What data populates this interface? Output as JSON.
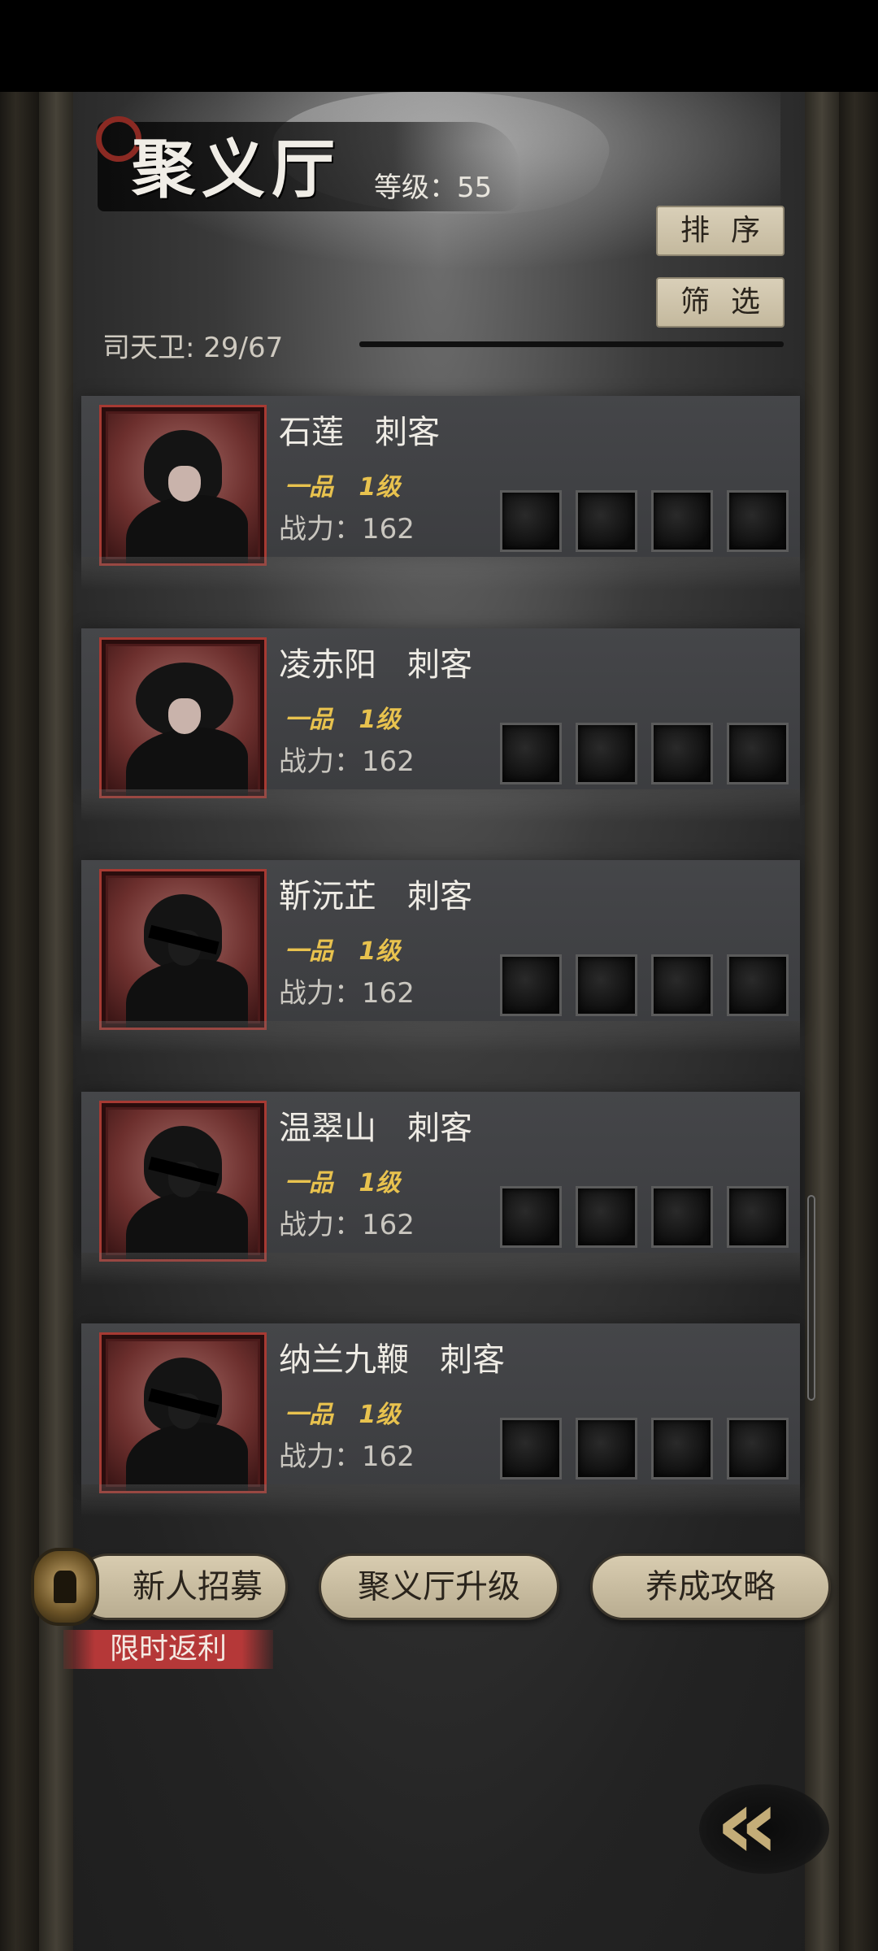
{
  "header": {
    "title": "聚义厅",
    "level_label": "等级：55",
    "guard_count": "司天卫: 29/67",
    "sort_label": "排序",
    "filter_label": "筛选"
  },
  "members": [
    {
      "name": "石莲",
      "role": "刺客",
      "grade": "一品",
      "level": "1级",
      "power": "战力：162",
      "portrait": "female-hooded"
    },
    {
      "name": "凌赤阳",
      "role": "刺客",
      "grade": "一品",
      "level": "1级",
      "power": "战力：162",
      "portrait": "female-circlet"
    },
    {
      "name": "靳沅芷",
      "role": "刺客",
      "grade": "一品",
      "level": "1级",
      "power": "战力：162",
      "portrait": "shadow-silhouette"
    },
    {
      "name": "温翠山",
      "role": "刺客",
      "grade": "一品",
      "level": "1级",
      "power": "战力：162",
      "portrait": "shadow-silhouette"
    },
    {
      "name": "纳兰九鞭",
      "role": "刺客",
      "grade": "一品",
      "level": "1级",
      "power": "战力：162",
      "portrait": "shadow-silhouette"
    }
  ],
  "actions": {
    "recruit": "新人招募",
    "recruit_promo": "限时返利",
    "upgrade": "聚义厅升级",
    "guide": "养成攻略"
  },
  "icons": {
    "back": "double-chevron-left-icon",
    "recruit": "recruit-token-icon",
    "slot": "empty-equipment-slot-icon"
  },
  "colors": {
    "accent_gold": "#e8c24e",
    "portrait_border": "#a73a33",
    "button_beige": "#d8ccb0",
    "promo_red": "#b53838"
  }
}
